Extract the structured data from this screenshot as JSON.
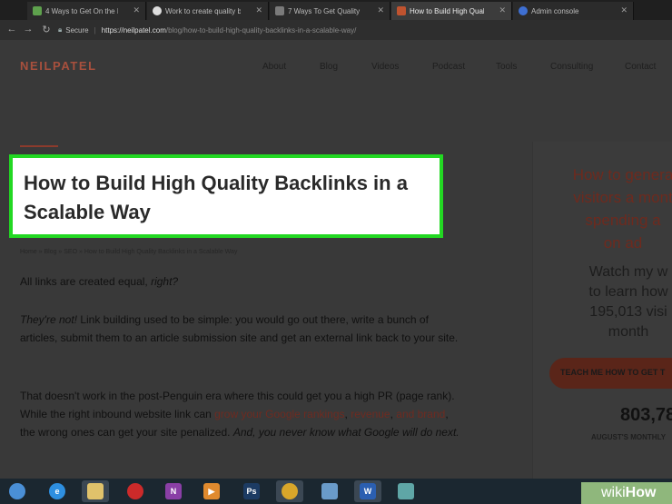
{
  "browser": {
    "tabs": [
      {
        "label": "4 Ways to Get On the F",
        "icon": "wikihow-tab-icon",
        "color": "#5ea14d",
        "active": false
      },
      {
        "label": "Work to create quality b",
        "icon": "google-tab-icon",
        "color": "#dddddd",
        "active": false
      },
      {
        "label": "7 Ways To Get Quality B",
        "icon": "doc-tab-icon",
        "color": "#7a7a7a",
        "active": false
      },
      {
        "label": "How to Build High Qual",
        "icon": "neilpatel-tab-icon",
        "color": "#c0532f",
        "active": true
      },
      {
        "label": "Admin console",
        "icon": "admin-tab-icon",
        "color": "#3e6fd2",
        "active": false
      }
    ],
    "secure_label": "Secure",
    "url_host": "https://neilpatel.com",
    "url_path": "/blog/how-to-build-high-quality-backlinks-in-a-scalable-way/"
  },
  "site": {
    "logo": "NEILPATEL",
    "nav": [
      "About",
      "Blog",
      "Videos",
      "Podcast",
      "Tools",
      "Consulting",
      "Contact"
    ]
  },
  "article": {
    "title": "How to Build High Quality Backlinks in a Scalable Way",
    "breadcrumb": "Home » Blog » SEO » How to Build High Quality Backlinks in a Scalable Way",
    "p1_text": "All links are created equal, ",
    "p1_italic": "right?",
    "p2_italic": "They're not!",
    "p2_text": " Link building used to be simple: you would go out there, write a bunch of articles, submit them to an article submission site and get an external link back to your site.",
    "p3_a": "That doesn't work in the post-Penguin era where this could get you a high PR (page rank). While the right inbound website link can ",
    "p3_link1": "grow your Google rankings",
    "p3_b": ", ",
    "p3_link2": "revenue",
    "p3_c": ", ",
    "p3_link3": "and brand",
    "p3_d": ", the wrong ones can get your site penalized. ",
    "p3_italic": "And, you never know what Google will do next."
  },
  "sidebar": {
    "title_lines": [
      "How to genera",
      "visitors a mont",
      "spending a",
      "on ad"
    ],
    "text_lines": [
      "Watch my w",
      "to learn how",
      "195,013 visi",
      "month"
    ],
    "cta": "TEACH ME HOW TO GET T",
    "number": "803,78",
    "sub": "AUGUST'S MONTHLY"
  },
  "taskbar": {
    "items": [
      {
        "name": "start-orb-icon",
        "glyph": "",
        "color": "#4a8fd6"
      },
      {
        "name": "internet-explorer-icon",
        "glyph": "e",
        "color": "#2e8fe0"
      },
      {
        "name": "file-explorer-icon",
        "glyph": "",
        "color": "#e0c26b"
      },
      {
        "name": "media-player-icon",
        "glyph": "",
        "color": "#cc2a2a"
      },
      {
        "name": "onenote-icon",
        "glyph": "N",
        "color": "#8a3fa6"
      },
      {
        "name": "play-app-icon",
        "glyph": "▶",
        "color": "#e08a2e"
      },
      {
        "name": "photoshop-icon",
        "glyph": "Ps",
        "color": "#1c3b63"
      },
      {
        "name": "chrome-icon",
        "glyph": "",
        "color": "#d9a62a"
      },
      {
        "name": "paint-app-icon",
        "glyph": "",
        "color": "#6a9bc9"
      },
      {
        "name": "word-icon",
        "glyph": "W",
        "color": "#2b5fb1"
      },
      {
        "name": "notes-app-icon",
        "glyph": "",
        "color": "#5fa6a6"
      }
    ],
    "watermark_a": "wiki",
    "watermark_b": "How"
  }
}
